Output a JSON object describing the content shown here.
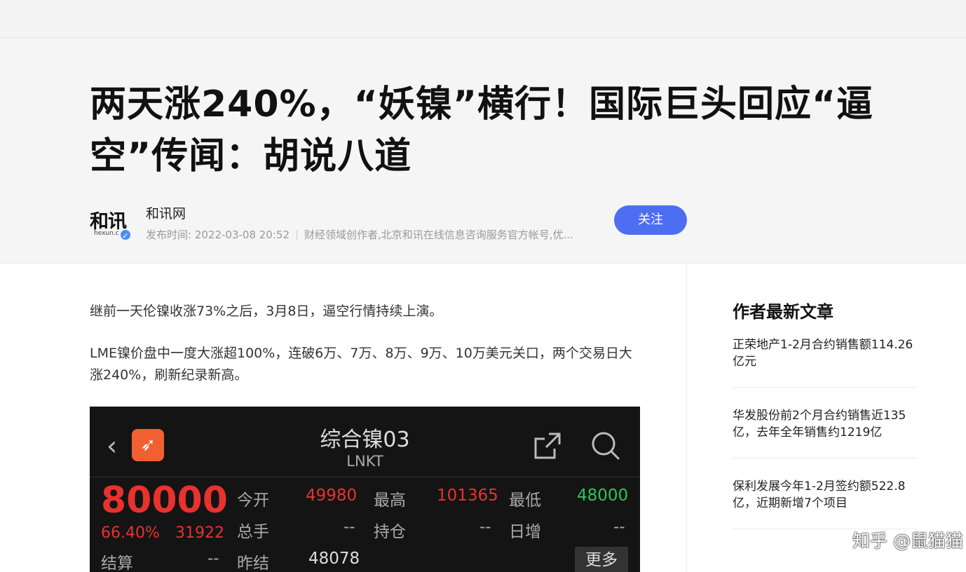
{
  "article": {
    "title": "两天涨240%，“妖镍”横行！国际巨头回应“逼空”传闻：胡说八道",
    "author_name": "和讯网",
    "publish_label": "发布时间: 2022-03-08 20:52",
    "author_desc": "财经领域创作者,北京和讯在线信息咨询服务官方帐号,优...",
    "follow_label": "关注",
    "avatar_logo": "和讯",
    "avatar_sub": "hexun.c",
    "paragraphs": [
      "继前一天伦镍收涨73%之后，3月8日，逼空行情持续上演。",
      "LME镍价盘中一度大涨超100%，连破6万、7万、8万、9万、10万美元关口，两个交易日大涨240%，刷新纪录新高。"
    ]
  },
  "quote_screenshot": {
    "title": "综合镍03",
    "symbol": "LNKT",
    "price": "80000",
    "change_pct": "66.40%",
    "change_abs": "31922",
    "rows": {
      "open_label": "今开",
      "open_value": "49980",
      "high_label": "最高",
      "high_value": "101365",
      "low_label": "最低",
      "low_value": "48000",
      "volume_label": "总手",
      "volume_value": "--",
      "position_label": "持仓",
      "position_value": "--",
      "daily_inc_label": "日增",
      "daily_inc_value": "--",
      "settle_label": "结算",
      "settle_value": "--",
      "prev_settle_label": "昨结",
      "prev_settle_value": "48078"
    },
    "more_label": "更多"
  },
  "sidebar": {
    "title": "作者最新文章",
    "items": [
      "正荣地产1-2月合约销售额114.26亿元",
      "华发股份前2个月合约销售近135亿，去年全年销售约1219亿",
      "保利发展今年1-2月签约额522.8亿，近期新增7个项目"
    ]
  },
  "watermark": "知乎 @鼠猫猫",
  "icons": [
    "back-arrow-icon",
    "app-logo-icon",
    "share-icon",
    "search-icon",
    "verified-icon"
  ],
  "colors": {
    "follow": "#4e6ef2",
    "up": "#e8322e",
    "down": "#2fc45a"
  }
}
